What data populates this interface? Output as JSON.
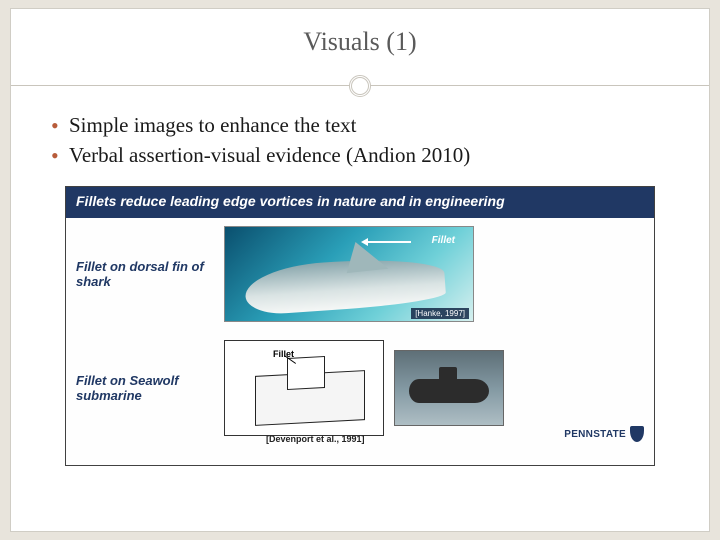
{
  "title": "Visuals (1)",
  "bullets": [
    "Simple images to enhance the text",
    "Verbal assertion-visual evidence (Andion 2010)"
  ],
  "embed": {
    "header": "Fillets reduce leading edge vortices in nature and in engineering",
    "rows": [
      {
        "label": "Fillet on dorsal fin of shark"
      },
      {
        "label": "Fillet on Seawolf submarine"
      }
    ],
    "shark_annotation": "Fillet",
    "citation_shark": "[Hanke, 1997]",
    "diagram_annotation": "Fillet",
    "citation_diagram": "[Devenport et al., 1991]",
    "logo_text": "PENNSTATE"
  }
}
